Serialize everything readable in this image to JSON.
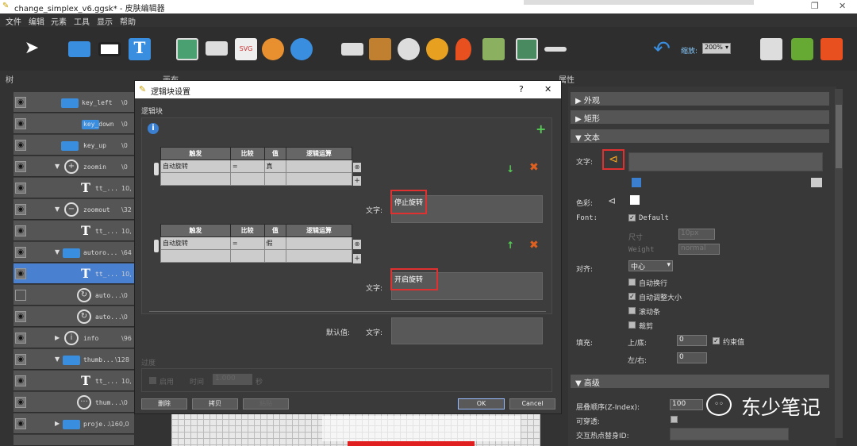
{
  "app": {
    "title": "change_simplex_v6.ggsk* - 皮肤编辑器"
  },
  "menu": [
    "文件",
    "编辑",
    "元素",
    "工具",
    "显示",
    "帮助"
  ],
  "toolbar": {
    "zoom_label": "缩放:",
    "zoom_value": "200%"
  },
  "panels": {
    "tree_title": "树",
    "canvas_title": "画布",
    "props_title": "属性"
  },
  "tree": [
    {
      "name": "key_left",
      "value": "\\0"
    },
    {
      "name": "key_down",
      "value": "\\0"
    },
    {
      "name": "key_up",
      "value": "\\0"
    },
    {
      "name": "zoomin",
      "value": "\\0"
    },
    {
      "name": "tt_...",
      "value": "10,"
    },
    {
      "name": "zoomout",
      "value": "\\32"
    },
    {
      "name": "tt_...",
      "value": "10,"
    },
    {
      "name": "autoro...",
      "value": "\\64"
    },
    {
      "name": "tt_...",
      "value": "10,"
    },
    {
      "name": "auto...",
      "value": "\\0"
    },
    {
      "name": "auto...",
      "value": "\\0"
    },
    {
      "name": "info",
      "value": "\\96"
    },
    {
      "name": "thumb...",
      "value": "\\128"
    },
    {
      "name": "tt_...",
      "value": "10,"
    },
    {
      "name": "thum...",
      "value": "\\0"
    },
    {
      "name": "proje...",
      "value": "\\160,0"
    },
    {
      "name": "",
      "value": ""
    }
  ],
  "dialog": {
    "title": "逻辑块设置",
    "help": "?",
    "close": "✕",
    "section": "逻辑块",
    "headers": [
      "触发",
      "比较",
      "值",
      "逻辑运算"
    ],
    "block1": {
      "trigger": "自动旋转",
      "compare": "=",
      "value": "真",
      "text_label": "文字:",
      "text_value": "停止旋转"
    },
    "block2": {
      "trigger": "自动旋转",
      "compare": "=",
      "value": "假",
      "text_label": "文字:",
      "text_value": "开启旋转"
    },
    "default_label": "默认值:",
    "default_text_label": "文字:",
    "transition": {
      "title": "过度",
      "enable": "启用",
      "time_label": "时间",
      "time_value": "1.000",
      "unit": "秒"
    },
    "buttons": {
      "delete": "删除",
      "copy": "拷贝",
      "paste": "粘贴",
      "ok": "OK",
      "cancel": "Cancel"
    }
  },
  "props": {
    "sections": {
      "appearance": "外观",
      "rect": "矩形",
      "text": "文本",
      "advanced": "高级"
    },
    "text_label": "文字:",
    "color_label": "色彩:",
    "font_label": "Font:",
    "font_default": "Default",
    "size_label": "尺寸",
    "size_value": "10px",
    "weight_label": "Weight",
    "weight_value": "normal",
    "align_label": "对齐:",
    "align_value": "中心",
    "wrap": "自动换行",
    "autosize": "自动调整大小",
    "scrollbar": "滚动条",
    "crop": "裁剪",
    "fill_label": "填充:",
    "topbottom_label": "上/底:",
    "topbottom_value": "0",
    "constrain": "约束值",
    "leftright_label": "左/右:",
    "leftright_value": "0",
    "zindex_label": "层叠顺序(Z-Index):",
    "zindex_value": "100",
    "passthrough_label": "可穿透:",
    "hotspot_label": "交互热点替身ID:"
  },
  "watermark": "东少笔记"
}
